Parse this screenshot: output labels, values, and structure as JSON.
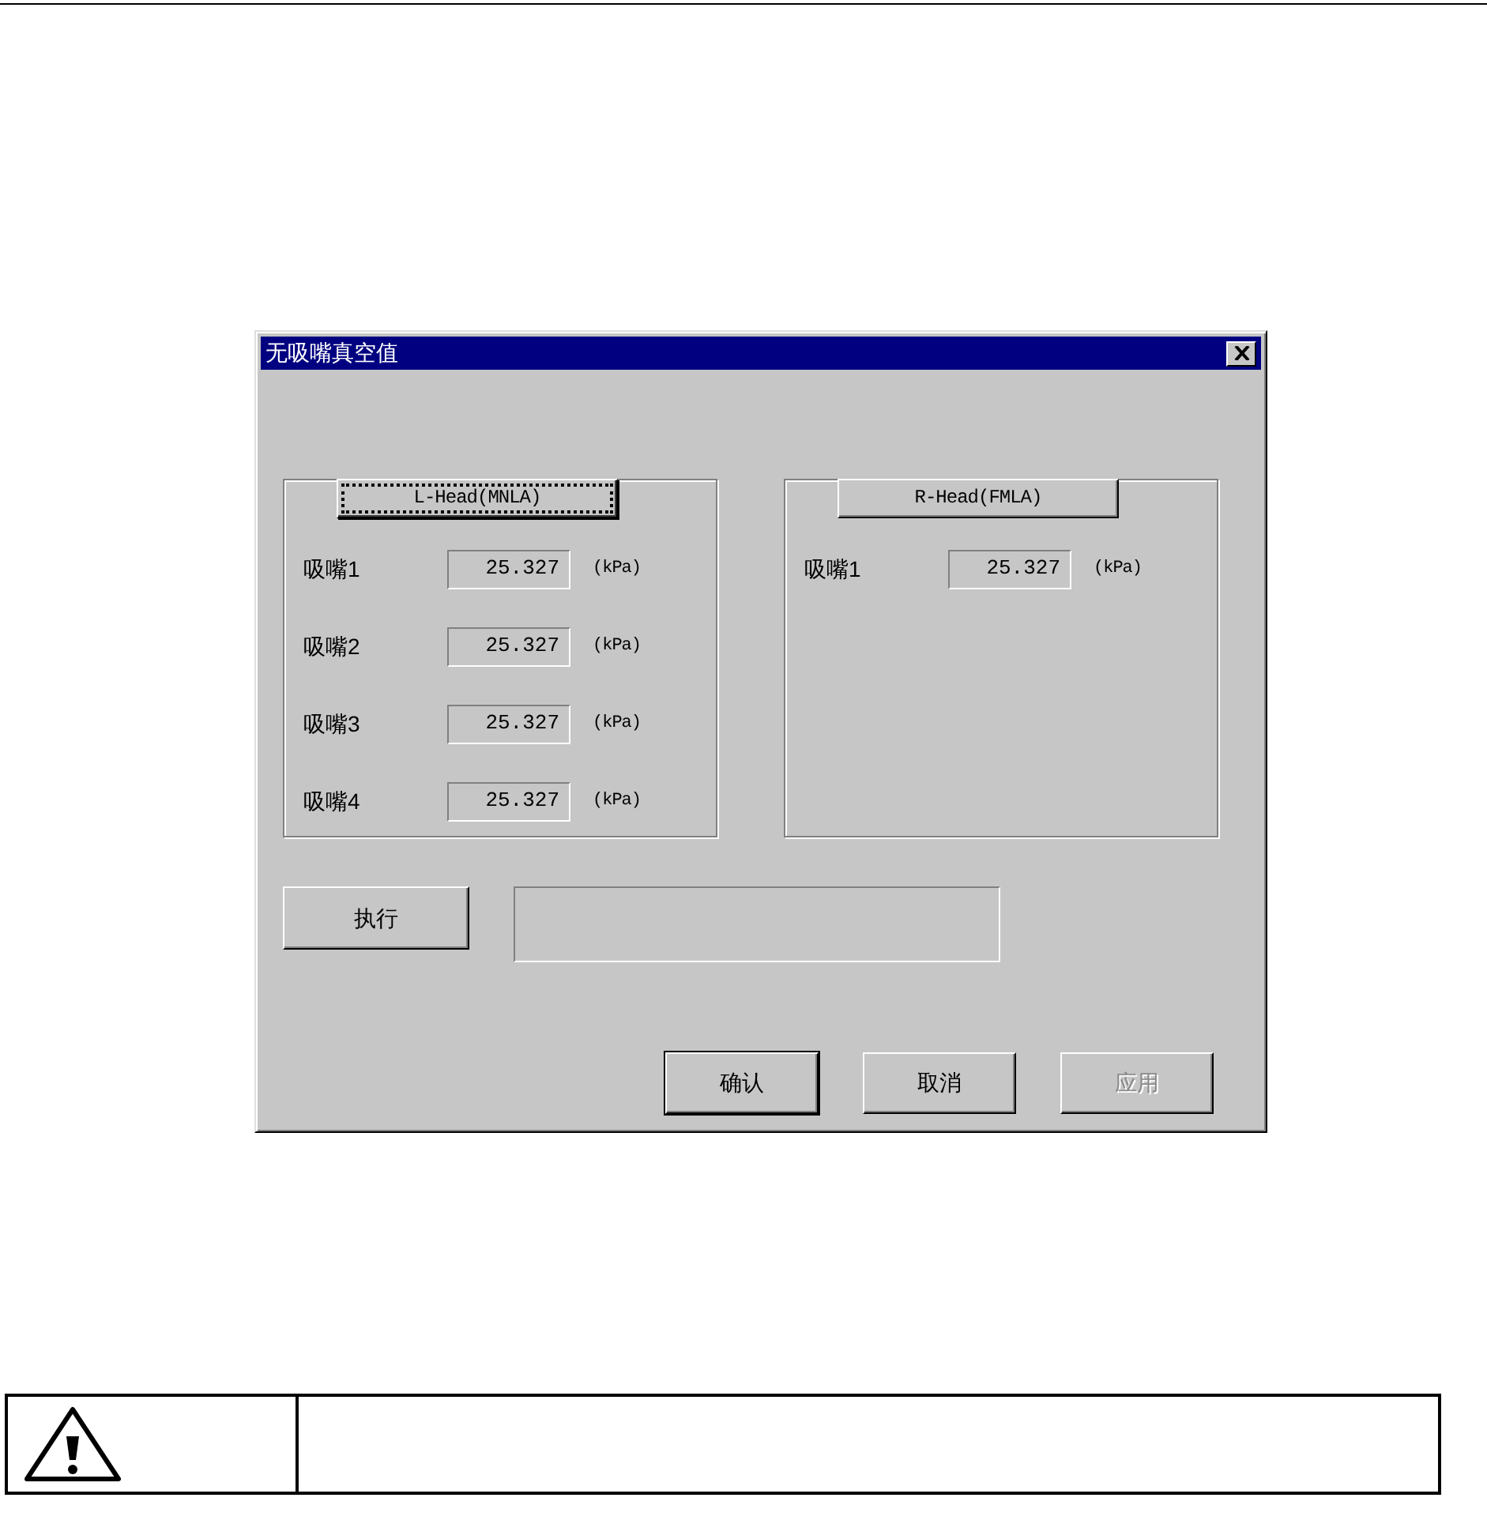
{
  "dialog": {
    "title": "无吸嘴真空值",
    "groups": [
      {
        "header": "L-Head(MNLA)",
        "focused": true,
        "rows": [
          {
            "label": "吸嘴1",
            "value": "25.327",
            "unit": "(kPa)"
          },
          {
            "label": "吸嘴2",
            "value": "25.327",
            "unit": "(kPa)"
          },
          {
            "label": "吸嘴3",
            "value": "25.327",
            "unit": "(kPa)"
          },
          {
            "label": "吸嘴4",
            "value": "25.327",
            "unit": "(kPa)"
          }
        ]
      },
      {
        "header": "R-Head(FMLA)",
        "focused": false,
        "rows": [
          {
            "label": "吸嘴1",
            "value": "25.327",
            "unit": "(kPa)"
          }
        ]
      }
    ],
    "execute_button": "执行",
    "buttons": [
      {
        "label": "确认",
        "default": true,
        "disabled": false
      },
      {
        "label": "取消",
        "default": false,
        "disabled": false
      },
      {
        "label": "应用",
        "default": false,
        "disabled": true
      }
    ]
  }
}
